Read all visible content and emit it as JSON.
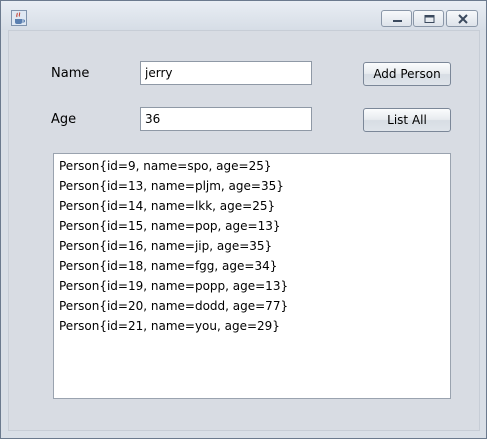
{
  "window": {
    "title": "",
    "icon": "java-cup-icon",
    "controls": [
      "minimize-icon",
      "maximize-icon",
      "close-icon"
    ]
  },
  "form": {
    "name_label": "Name",
    "name_value": "jerry",
    "age_label": "Age",
    "age_value": "36",
    "add_button_label": "Add Person",
    "list_button_label": "List All"
  },
  "results": [
    "Person{id=9, name=spo, age=25}",
    "Person{id=13, name=pljm, age=35}",
    "Person{id=14, name=lkk, age=25}",
    "Person{id=15, name=pop, age=13}",
    "Person{id=16, name=jip, age=35}",
    "Person{id=18, name=fgg, age=34}",
    "Person{id=19, name=popp, age=13}",
    "Person{id=20, name=dodd, age=77}",
    "Person{id=21, name=you, age=29}"
  ],
  "colors": {
    "background": "#d8dce3",
    "titlebar": "#e3e8ef",
    "button_border": "#7b8798",
    "field_border": "#8f99a6"
  }
}
